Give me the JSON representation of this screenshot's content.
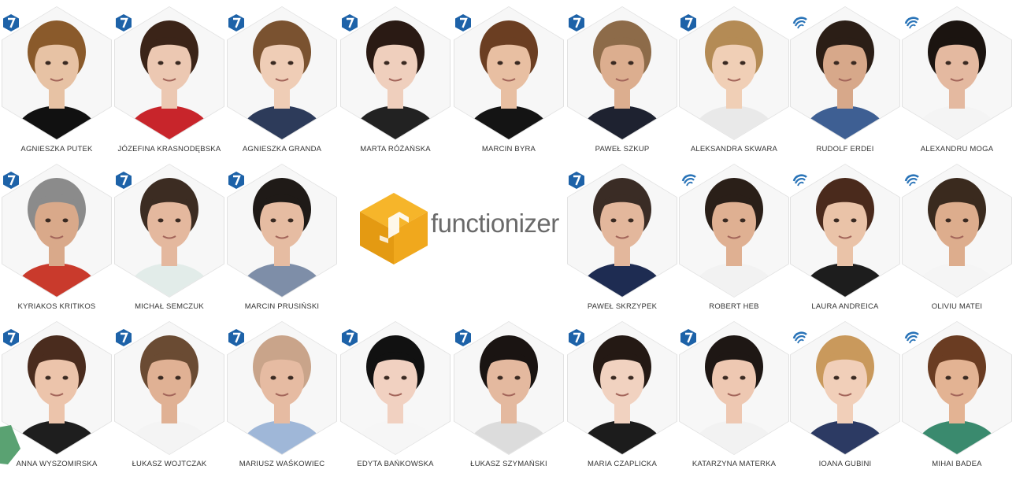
{
  "brand": {
    "name": "functionizer",
    "accent": "#f2a91c",
    "accent_dark": "#d48a07"
  },
  "badge_colors": {
    "seven": "#1d62a8",
    "swirl": "#2a74b8"
  },
  "rows": [
    [
      {
        "name": "AGNIESZKA PUTEK",
        "badge": "seven",
        "hair": "#8a5a2b",
        "skin": "#e7c2a4",
        "shirt": "#111111"
      },
      {
        "name": "JÓZEFINA KRASNODĘBSKA",
        "badge": "seven",
        "hair": "#3b2418",
        "skin": "#ecc8b2",
        "shirt": "#c8252b"
      },
      {
        "name": "AGNIESZKA GRANDA",
        "badge": "seven",
        "hair": "#7a5230",
        "skin": "#efcdb6",
        "shirt": "#2d3b5a"
      },
      {
        "name": "MARTA RÓŻAŃSKA",
        "badge": "seven",
        "hair": "#2a1a14",
        "skin": "#efcfbd",
        "shirt": "#222222"
      },
      {
        "name": "MARCIN BYRA",
        "badge": "seven",
        "hair": "#6b3e22",
        "skin": "#e8bfa2",
        "shirt": "#141414"
      },
      {
        "name": "PAWEŁ SZKUP",
        "badge": "seven",
        "hair": "#8d6b49",
        "skin": "#dcae8f",
        "shirt": "#1e2230"
      },
      {
        "name": "ALEKSANDRA SKWARA",
        "badge": "seven",
        "hair": "#b48b55",
        "skin": "#f0cfb6",
        "shirt": "#e9e9e9"
      },
      {
        "name": "RUDOLF ERDEI",
        "badge": "swirl",
        "hair": "#2b1e16",
        "skin": "#d7a88a",
        "shirt": "#3e5f93"
      },
      {
        "name": "ALEXANDRU MOGA",
        "badge": "swirl",
        "hair": "#1b1410",
        "skin": "#e4b9a0",
        "shirt": "#f4f4f4"
      }
    ],
    [
      {
        "name": "KYRIAKOS KRITIKOS",
        "badge": "seven",
        "hair": "#8b8b8b",
        "skin": "#d9a98a",
        "shirt": "#c93a2c"
      },
      {
        "name": "MICHAŁ SEMCZUK",
        "badge": "seven",
        "hair": "#3c2c22",
        "skin": "#e4b89e",
        "shirt": "#e2ece9"
      },
      {
        "name": "MARCIN PRUSIŃSKI",
        "badge": "seven",
        "hair": "#1f1a17",
        "skin": "#e6bca2",
        "shirt": "#7e8ea8"
      },
      {
        "name": "PAWEŁ SKRZYPEK",
        "badge": "seven",
        "hair": "#3a2c25",
        "skin": "#e3b79c",
        "shirt": "#1e2c52"
      },
      {
        "name": "ROBERT HEB",
        "badge": "swirl",
        "hair": "#2a1f18",
        "skin": "#dfb092",
        "shirt": "#f2f2f2"
      },
      {
        "name": "LAURA ANDREICA",
        "badge": "swirl",
        "hair": "#4a2a1c",
        "skin": "#eac3a8",
        "shirt": "#1d1d1d"
      },
      {
        "name": "OLIVIU MATEI",
        "badge": "swirl",
        "hair": "#3a2a1e",
        "skin": "#ddad8d",
        "shirt": "#f5f5f5"
      }
    ],
    [
      {
        "name": "ANNA WYSZOMIRSKA",
        "badge": "seven",
        "hair": "#4a2c1e",
        "skin": "#ecc4ab",
        "shirt": "#1e1e1e"
      },
      {
        "name": "ŁUKASZ WOJTCZAK",
        "badge": "seven",
        "hair": "#6a4b33",
        "skin": "#e0b194",
        "shirt": "#f4f4f4"
      },
      {
        "name": "MARIUSZ WAŚKOWIEC",
        "badge": "seven",
        "hair": "#c9a48a",
        "skin": "#e6bba2",
        "shirt": "#9fb7d8"
      },
      {
        "name": "EDYTA BAŃKOWSKA",
        "badge": "seven",
        "hair": "#111111",
        "skin": "#f1d1c1",
        "shirt": "#f6f6f6"
      },
      {
        "name": "ŁUKASZ SZYMAŃSKI",
        "badge": "seven",
        "hair": "#1a1412",
        "skin": "#e4b99f",
        "shirt": "#dcdcdc"
      },
      {
        "name": "MARIA CZAPLICKA",
        "badge": "seven",
        "hair": "#241914",
        "skin": "#f1d2c0",
        "shirt": "#1c1c1c"
      },
      {
        "name": "KATARZYNA MATERKA",
        "badge": "seven",
        "hair": "#1e1714",
        "skin": "#eec8b2",
        "shirt": "#f2f2f2"
      },
      {
        "name": "IOANA GUBINI",
        "badge": "swirl",
        "hair": "#c9995c",
        "skin": "#f1cfb9",
        "shirt": "#2c3a63"
      },
      {
        "name": "MIHAI BADEA",
        "badge": "swirl",
        "hair": "#6a3c22",
        "skin": "#e3b393",
        "shirt": "#3a8a6e"
      }
    ]
  ]
}
